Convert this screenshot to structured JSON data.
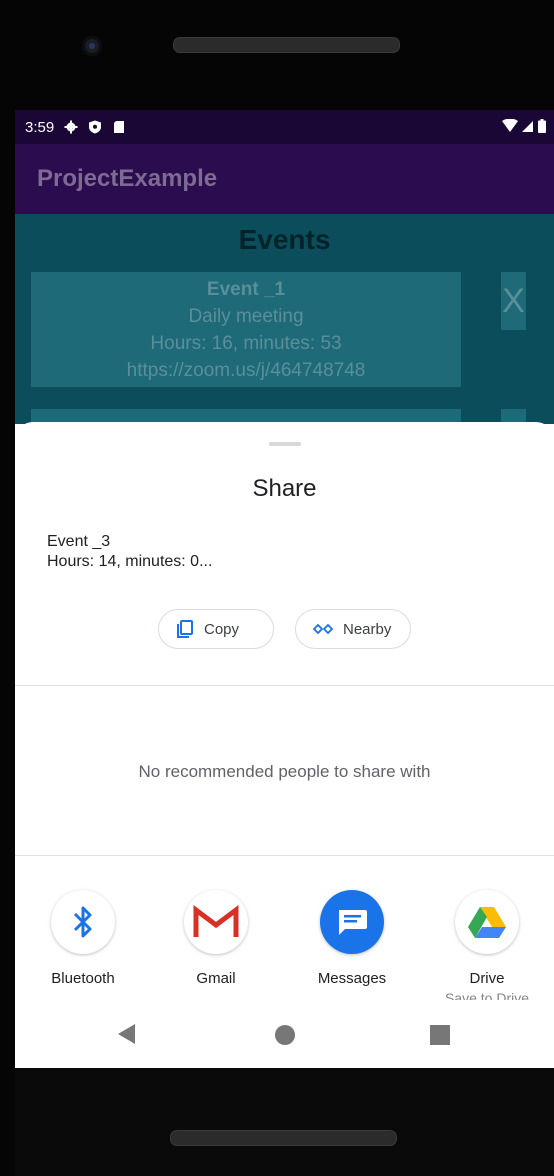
{
  "status_bar": {
    "time": "3:59"
  },
  "app_bar": {
    "title": "ProjectExample"
  },
  "events_screen": {
    "heading": "Events",
    "event": {
      "name": "Event _1",
      "description": "Daily meeting",
      "duration": "Hours: 16, minutes: 53",
      "link": "https://zoom.us/j/464748748"
    },
    "delete_label": "X"
  },
  "share_sheet": {
    "title": "Share",
    "preview_line1": "Event _3",
    "preview_line2": "Hours: 14, minutes: 0...",
    "copy_label": "Copy",
    "nearby_label": "Nearby",
    "no_people": "No recommended people to share with",
    "apps": [
      {
        "label": "Bluetooth",
        "icon": "bluetooth-icon",
        "sub": ""
      },
      {
        "label": "Gmail",
        "icon": "gmail-icon",
        "sub": ""
      },
      {
        "label": "Messages",
        "icon": "messages-icon",
        "sub": ""
      },
      {
        "label": "Drive",
        "icon": "drive-icon",
        "sub": "Save to Drive"
      }
    ]
  },
  "colors": {
    "status_bar": "#1a0736",
    "app_bar": "#2b0c4f",
    "content_bg": "#0c4d5b",
    "accent_blue": "#1a73e8"
  }
}
